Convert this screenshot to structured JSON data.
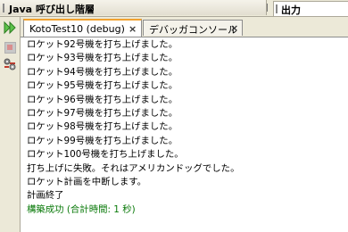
{
  "panels": {
    "left_title": "Java 呼び出し階層",
    "right_title": "出力"
  },
  "tabs": [
    {
      "label": "KotoTest10 (debug)",
      "close": "×"
    },
    {
      "label": "デバッガコンソール",
      "close": "×"
    }
  ],
  "toolbar": {
    "rerun_icon": "rerun-icon",
    "stop_icon": "stop-icon",
    "settings_icon": "settings-icon"
  },
  "output": {
    "lines": [
      "ロケット92号機を打ち上げました。",
      "ロケット93号機を打ち上げました。",
      "ロケット94号機を打ち上げました。",
      "ロケット95号機を打ち上げました。",
      "ロケット96号機を打ち上げました。",
      "ロケット97号機を打ち上げました。",
      "ロケット98号機を打ち上げました。",
      "ロケット99号機を打ち上げました。",
      "ロケット100号機を打ち上げました。",
      "打ち上げに失敗。それはアメリカンドッグでした。",
      "ロケット計画を中断します。",
      "計画終了"
    ],
    "success": "構築成功 (合計時間: 1 秒)"
  },
  "colors": {
    "success_text": "#0a7a0a",
    "active_tab_accent": "#f1a230"
  }
}
